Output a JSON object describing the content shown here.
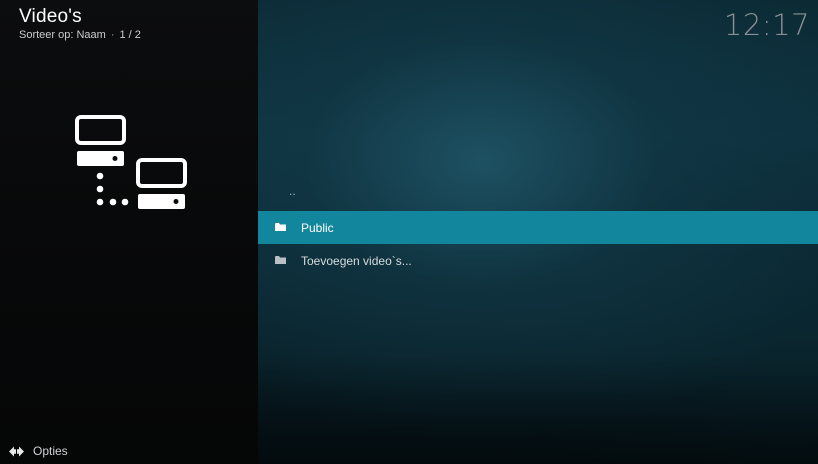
{
  "header": {
    "title": "Video's",
    "sort_label": "Sorteer op: Naam",
    "separator": "·",
    "page": "1 / 2"
  },
  "clock": "12:17",
  "left_panel": {
    "icon": "network-computers-icon"
  },
  "list": {
    "items": [
      {
        "label": "..",
        "icon": "",
        "type": "parent"
      },
      {
        "label": "Public",
        "icon": "folder-icon",
        "type": "folder",
        "selected": true
      },
      {
        "label": "Toevoegen video`s...",
        "icon": "folder-icon",
        "type": "folder",
        "selected": false
      }
    ]
  },
  "footer": {
    "options_label": "Opties",
    "options_icon": "options-arrows-icon"
  },
  "colors": {
    "selection": "#12869c",
    "clock": "#8a9196"
  }
}
